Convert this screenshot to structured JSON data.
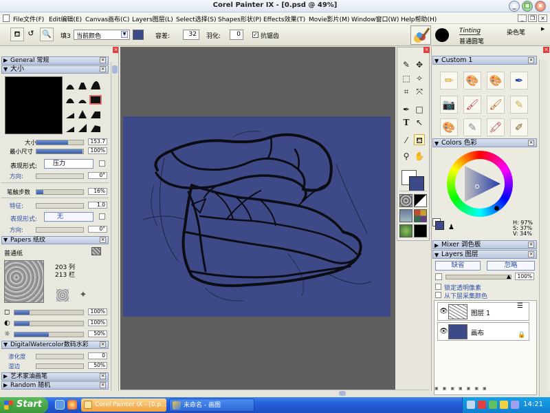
{
  "window": {
    "title": "Corel Painter IX - [0.psd @ 49%]",
    "controls": {
      "minimize": "_",
      "maximize": "□",
      "close": "×"
    }
  },
  "menubar": {
    "items": [
      "File文件(F)",
      "Edit编辑(E)",
      "Canvas画布(C)",
      "Layers图层(L)",
      "Select选择(S)",
      "Shapes形状(P)",
      "Effects效果(T)",
      "Movie影片(M)",
      "Window窗口(W)",
      "Help帮助(H)"
    ]
  },
  "propbar": {
    "fill_label": "填3",
    "fill_value": "当前颜色",
    "tolerance_label": "容差:",
    "tolerance_value": "32",
    "feather_label": "羽化:",
    "feather_value": "0",
    "antialias_label": "抗锯齿",
    "antialias_checked": true,
    "brush_category": "Tinting",
    "brush_category_cn": "染色笔",
    "brush_variant": "普通圆笔",
    "fill_color": "#3e4a88"
  },
  "left_panel": {
    "general_title": "General 常规",
    "size_title": "大小",
    "size": {
      "label": "大小",
      "value": "153.7"
    },
    "min_size": {
      "label": "最小尺寸",
      "value": "100%"
    },
    "expression1": {
      "label": "表现形式:",
      "value": "压力"
    },
    "direction1": {
      "label": "方向:",
      "value": "0°"
    },
    "brush_steps": {
      "label": "笔触步数",
      "value": "16%"
    },
    "feature": {
      "label": "特征:",
      "value": "1.0"
    },
    "expression2": {
      "label": "表现形式:",
      "value": "无"
    },
    "direction2": {
      "label": "方向:",
      "value": "0°"
    },
    "papers_title": "Papers 纸纹",
    "paper_name": "普通纸",
    "paper_cols": "203 列",
    "paper_rows": "213 栏",
    "paper_sliders": [
      "100%",
      "100%",
      "50%"
    ],
    "dwc_title": "DigitalWatercolor数码水彩",
    "diffusion": {
      "label": "渗化度",
      "value": "0"
    },
    "wet_fringe": {
      "label": "湿边",
      "value": "50%"
    },
    "artists_oils_title": "艺术家油画笔",
    "random_title": "Random 随机"
  },
  "right_panel": {
    "custom_title": "Custom 1",
    "brushes": [
      "pencil-icon",
      "palette-brush-icon",
      "palette-brush-icon",
      "ink-pen-icon",
      "camera-icon",
      "paintbrush-icon",
      "oil-brush-icon",
      "chalk-icon",
      "color-palette-icon",
      "pencil-gray-icon",
      "paint-tube-icon",
      "brush-tip-icon"
    ],
    "colors_title": "Colors 色彩",
    "hsv": {
      "h": "H: 97%",
      "s": "S: 37%",
      "v": "V: 34%"
    },
    "mixer_title": "Mixer 调色板",
    "layers_title": "Layers 图层",
    "composite_method": "缺省",
    "composite_depth": "忽略",
    "opacity": "100%",
    "preserve_transparency": "锁定透明像素",
    "pick_up_color": "从下层采集颜色",
    "layers": [
      {
        "name": "图层 1",
        "visible": true
      },
      {
        "name": "画布",
        "visible": true
      }
    ]
  },
  "taskbar": {
    "start_label": "Start",
    "tasks": [
      "Corel Painter IX - [0.p...",
      "未命名 - 画图"
    ],
    "clock": "14:21"
  }
}
